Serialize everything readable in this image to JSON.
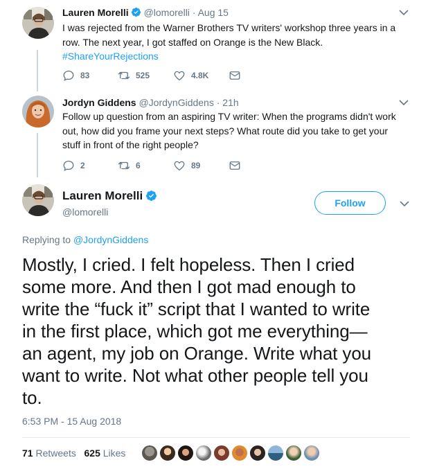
{
  "tweets": [
    {
      "name": "Lauren Morelli",
      "handle": "@lomorelli",
      "time": "· Aug 15",
      "text_lines": [
        "I was rejected from the Warner Brothers TV writers' workshop three years in a",
        "row. The next year, I got staffed on Orange is the New Black."
      ],
      "hashtag": "#ShareYourRejections",
      "replies": "83",
      "retweets": "525",
      "likes": "4.8K"
    },
    {
      "name": "Jordyn Giddens",
      "handle": "@JordynGiddens",
      "time": "· 21h",
      "text_lines": [
        "Follow up question from an aspiring TV writer: When the programs didn't work",
        "out, how did you frame your next steps? What route did you take to get your",
        "stuff in front of the right people?"
      ],
      "replies": "2",
      "retweets": "6",
      "likes": "89"
    }
  ],
  "main": {
    "name": "Lauren Morelli",
    "handle": "@lomorelli",
    "follow_label": "Follow",
    "replying_prefix": "Replying to",
    "replying_to": "@JordynGiddens",
    "text_lines": [
      "Mostly, I cried. I felt hopeless. Then I cried",
      "some more. And then I got mad enough to",
      "write the “fuck it” script that I wanted to write",
      "in the first place, which got me everything—",
      "an agent, my job on Orange. Write what you",
      "want to write. Not what other people tell you",
      "to."
    ],
    "timestamp": "6:53 PM - 15 Aug 2018",
    "retweet_count": "71",
    "retweet_label": "Retweets",
    "like_count": "625",
    "like_label": "Likes"
  },
  "colors": {
    "accent": "#1da1f2",
    "muted": "#657786",
    "text": "#14171a"
  },
  "icons": [
    "verified-icon",
    "chevron-down-icon",
    "reply-icon",
    "retweet-icon",
    "like-icon",
    "message-icon"
  ]
}
